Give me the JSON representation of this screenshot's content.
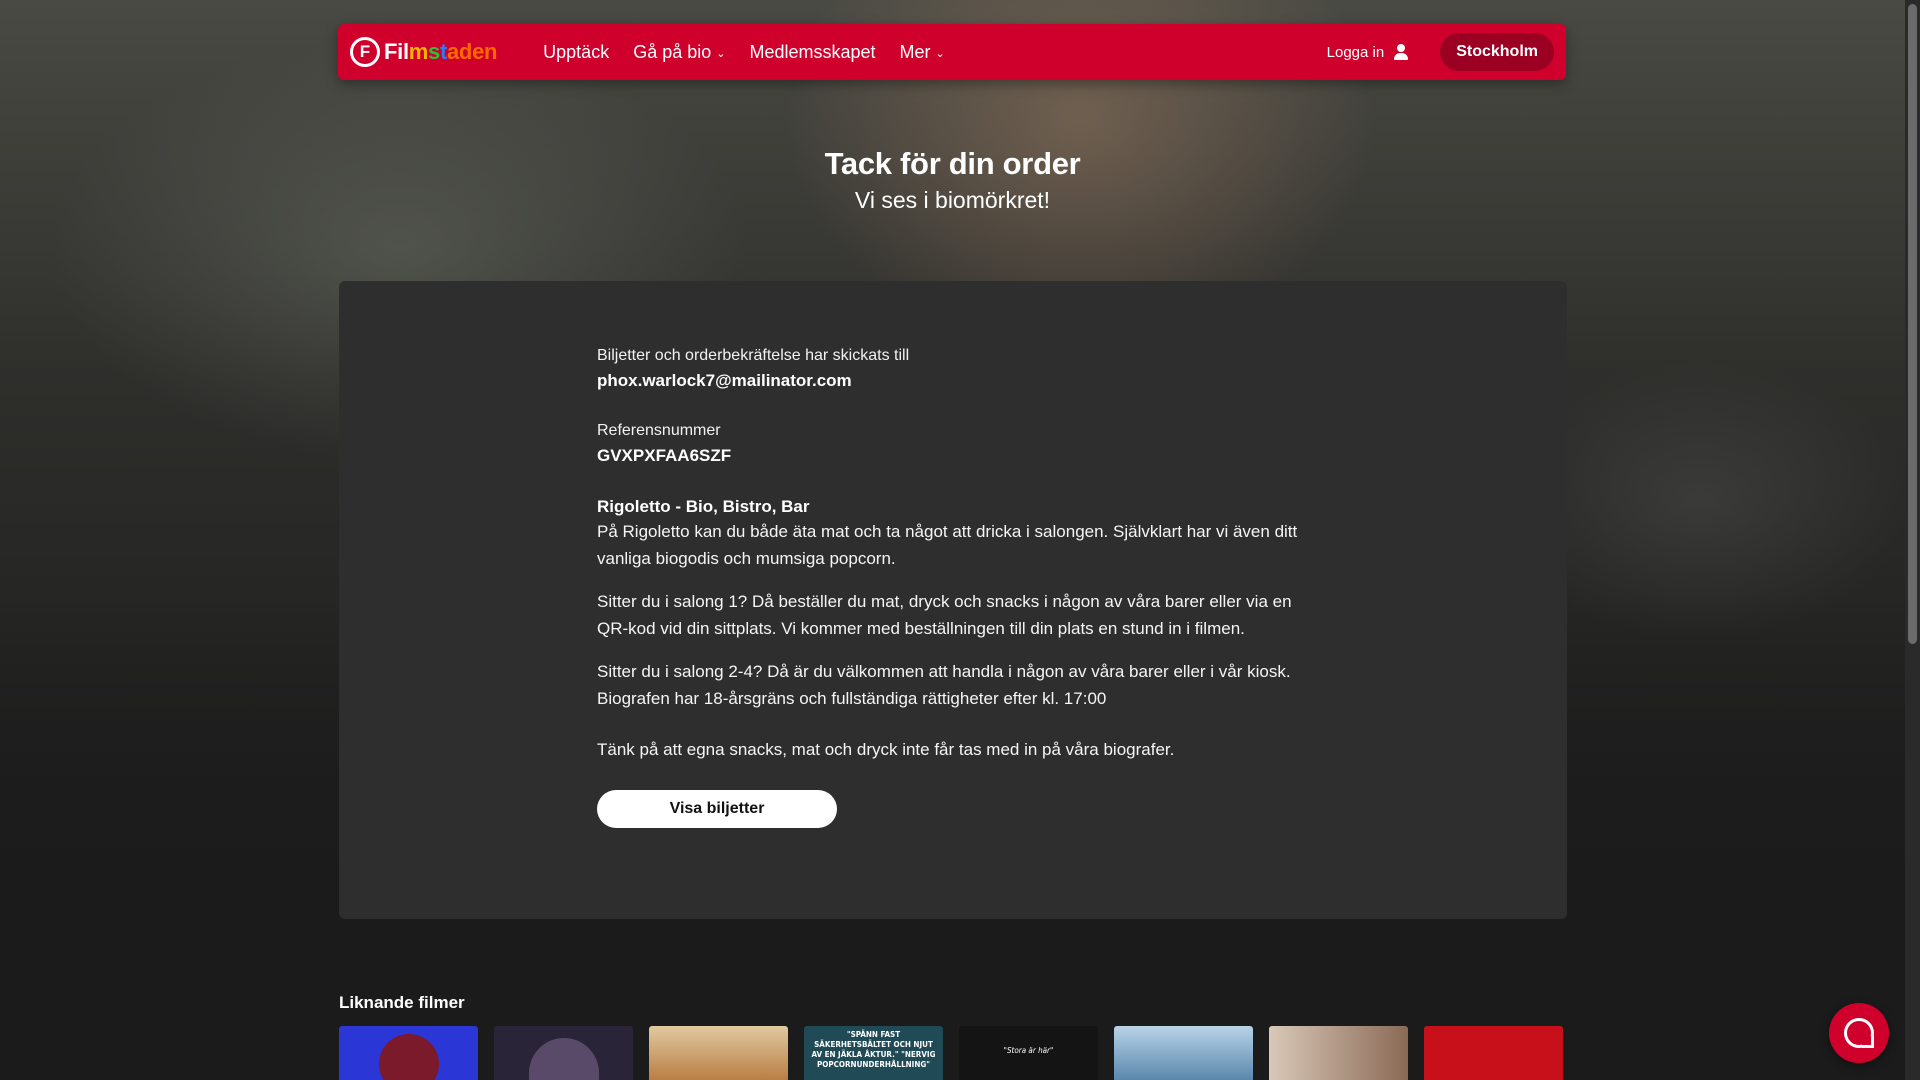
{
  "brand": {
    "logo_letter": "F",
    "logo_parts": [
      "Fil",
      "m",
      "s",
      "t",
      "aden"
    ],
    "accent_color": "#d0002d"
  },
  "nav": {
    "items": [
      {
        "label": "Upptäck",
        "has_dropdown": false
      },
      {
        "label": "Gå på bio",
        "has_dropdown": true
      },
      {
        "label": "Medlemsskapet",
        "has_dropdown": false
      },
      {
        "label": "Mer",
        "has_dropdown": true
      }
    ],
    "login_label": "Logga in",
    "login_icon": "user-icon",
    "city_label": "Stockholm"
  },
  "hero": {
    "title": "Tack för din order",
    "subtitle": "Vi ses i biomörkret!"
  },
  "confirmation": {
    "sent_to_label": "Biljetter och orderbekräftelse har skickats till",
    "email": "phox.warlock7@mailinator.com",
    "reference_label": "Referensnummer",
    "reference": "GVXPXFAA6SZF",
    "venue_title": "Rigoletto - Bio, Bistro, Bar",
    "paragraphs": [
      "På Rigoletto kan du både äta mat och ta något att dricka i salongen. Självklart har vi även ditt vanliga biogodis och mumsiga popcorn.",
      "Sitter du i salong 1? Då beställer du mat, dryck och snacks i någon av våra barer eller via en QR-kod vid din sittplats. Vi kommer med beställningen till din plats en stund in i filmen.",
      "Sitter du i salong 2-4? Då är du välkommen att handla i någon av våra barer eller i vår kiosk.",
      "Biografen har 18-årsgräns och fullständiga rättigheter efter kl. 17:00",
      "Tänk på att egna snacks, mat och dryck inte får tas med in på våra biografer."
    ],
    "tickets_button": "Visa biljetter"
  },
  "similar": {
    "title": "Liknande filmer",
    "posters": [
      {
        "text": "",
        "color": "#2b36d6"
      },
      {
        "text": "",
        "color": "#2a2438"
      },
      {
        "text": "",
        "color": "#b5763a"
      },
      {
        "text": "\"SPÄNN FAST SÄKERHETSBÄLTET OCH NJUT AV EN JÄKLA ÅKTUR.\" \"NERVIG POPCORNUNDERHÅLLNING\"",
        "color": "#1f4a56"
      },
      {
        "text": "\"Stora är här\"",
        "color": "#141414"
      },
      {
        "text": "",
        "color": "#4f7fa6"
      },
      {
        "text": "",
        "color": "#b9a28f"
      },
      {
        "text": "",
        "color": "#c8101a"
      }
    ]
  },
  "chat": {
    "icon": "chat-bubble-icon"
  }
}
